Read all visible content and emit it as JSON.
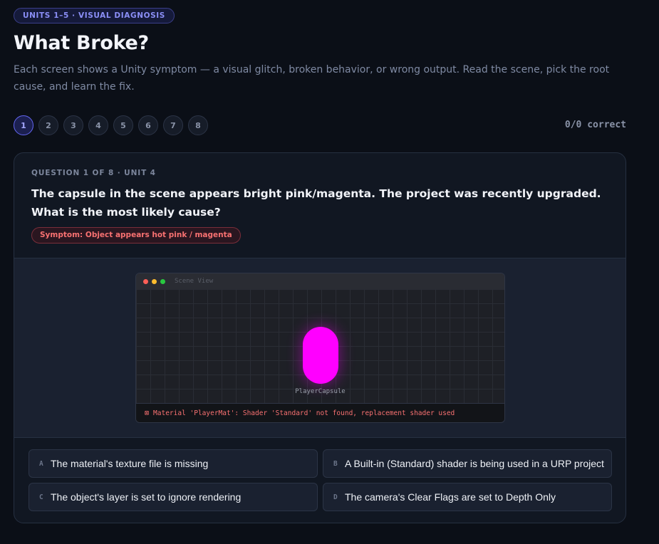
{
  "header": {
    "badge": "UNITS 1–5 · VISUAL DIAGNOSIS",
    "title": "What Broke?",
    "subtitle": "Each screen shows a Unity symptom — a visual glitch, broken behavior, or wrong output. Read the scene, pick the root cause, and learn the fix."
  },
  "steps": [
    "1",
    "2",
    "3",
    "4",
    "5",
    "6",
    "7",
    "8"
  ],
  "active_step": 1,
  "score": "0/0 correct",
  "question": {
    "meta": "QUESTION 1 OF 8 · UNIT 4",
    "text": "The capsule in the scene appears bright pink/magenta. The project was recently upgraded. What is the most likely cause?",
    "symptom": "Symptom: Object appears hot pink / magenta"
  },
  "scene": {
    "window_label": "Scene View",
    "object_label": "PlayerCapsule",
    "console_icon": "⊠",
    "console_message": "Material 'PlayerMat': Shader 'Standard' not found, replacement shader used",
    "dot_colors": [
      "#ff5f57",
      "#febc2e",
      "#28c840"
    ],
    "capsule_color": "#ff00ff"
  },
  "answers": [
    {
      "letter": "A",
      "text": "The material's texture file is missing"
    },
    {
      "letter": "B",
      "text": "A Built-in (Standard) shader is being used in a URP project"
    },
    {
      "letter": "C",
      "text": "The object's layer is set to ignore rendering"
    },
    {
      "letter": "D",
      "text": "The camera's Clear Flags are set to Depth Only"
    }
  ]
}
